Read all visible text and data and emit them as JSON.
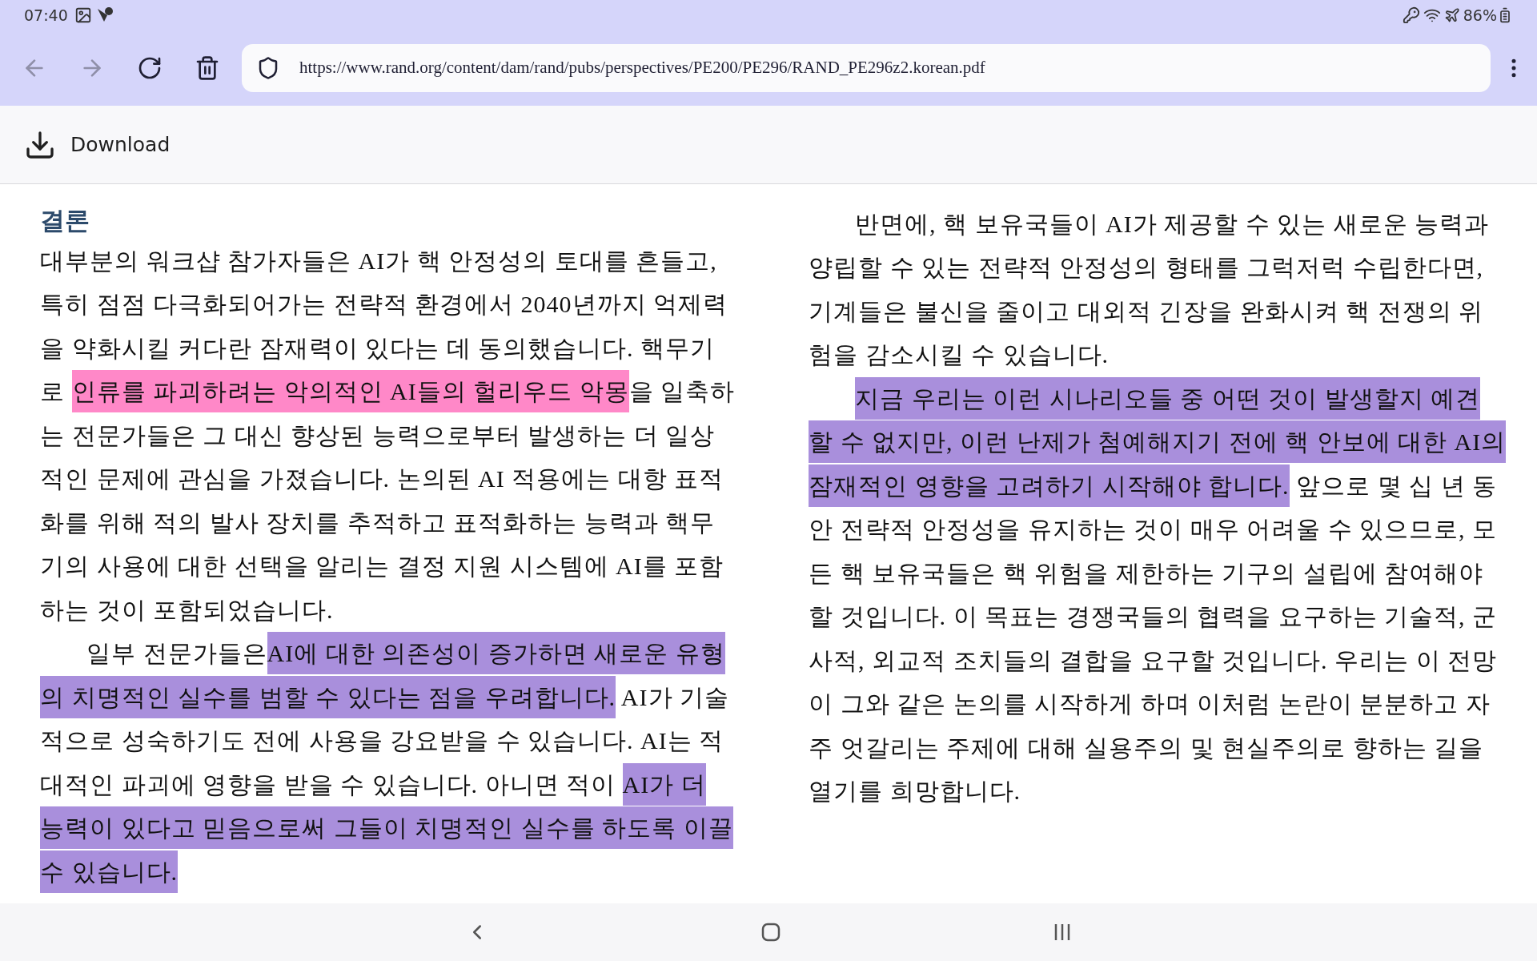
{
  "status_bar": {
    "time": "07:40",
    "battery": "86%"
  },
  "toolbar": {
    "buttons": [
      {
        "kind": "back",
        "disabled": true
      },
      {
        "kind": "forward",
        "disabled": true
      },
      {
        "kind": "reload",
        "disabled": false
      },
      {
        "kind": "delete",
        "disabled": false
      }
    ],
    "url": "https://www.rand.org/content/dam/rand/pubs/perspectives/PE200/PE296/RAND_PE296z2.korean.pdf"
  },
  "download_bar": {
    "label": "Download"
  },
  "document": {
    "columns": [
      {
        "heading": "결론",
        "paragraphs": [
          {
            "indent": false,
            "lines": [
              [
                {
                  "text": "대부분의 워크샵 참가자들은 AI가 핵 안정성의 토대를 흔들고,"
                }
              ],
              [
                {
                  "text": "특히 점점 다극화되어가는 전략적 환경에서 2040년까지 억제력"
                }
              ],
              [
                {
                  "text": "을 약화시킬 커다란 잠재력이 있다는 데 동의했습니다. 핵무기"
                }
              ],
              [
                {
                  "text": "로 "
                },
                {
                  "text": "인류를 파괴하려는 악의적인 AI들의 헐리우드 악몽",
                  "color": "#ff88c8"
                },
                {
                  "text": "을 일축하"
                }
              ],
              [
                {
                  "text": "는 전문가들은 그 대신 향상된 능력으로부터 발생하는 더 일상"
                }
              ],
              [
                {
                  "text": "적인 문제에 관심을 가졌습니다. 논의된 AI 적용에는 대항 표적"
                }
              ],
              [
                {
                  "text": "화를 위해 적의 발사 장치를 추적하고 표적화하는 능력과 핵무"
                }
              ],
              [
                {
                  "text": "기의 사용에 대한 선택을 알리는 결정 지원 시스템에 AI를 포함"
                }
              ],
              [
                {
                  "text": "하는 것이 포함되었습니다."
                }
              ]
            ]
          },
          {
            "indent": true,
            "lines": [
              [
                {
                  "text": "일부 전문가들은"
                },
                {
                  "text": "AI에 대한 의존성이 증가하면 새로운 유형",
                  "color": "#a98fdc"
                }
              ],
              [
                {
                  "text": "의 치명적인 실수를 범할 수 있다는 점을 우려합니다.",
                  "color": "#a98fdc"
                },
                {
                  "text": " AI가 기술"
                }
              ],
              [
                {
                  "text": "적으로 성숙하기도 전에 사용을 강요받을 수 있습니다. AI는 적"
                }
              ],
              [
                {
                  "text": "대적인 파괴에 영향을 받을 수 있습니다. 아니면 적이 "
                },
                {
                  "text": "AI가 더",
                  "color": "#a98fdc"
                }
              ],
              [
                {
                  "text": "능력이 있다고 믿음으로써 그들이 치명적인 실수를 하도록 이끌",
                  "color": "#a98fdc"
                }
              ],
              [
                {
                  "text": "수 있습니다.",
                  "color": "#a98fdc"
                }
              ]
            ]
          }
        ]
      },
      {
        "paragraphs": [
          {
            "indent": true,
            "lines": [
              [
                {
                  "text": "반면에, 핵 보유국들이 AI가 제공할 수 있는 새로운 능력과"
                }
              ],
              [
                {
                  "text": "양립할 수 있는 전략적 안정성의 형태를 그럭저럭 수립한다면,"
                }
              ],
              [
                {
                  "text": "기계들은 불신을 줄이고 대외적 긴장을 완화시켜 핵 전쟁의 위"
                }
              ],
              [
                {
                  "text": "험을 감소시킬 수 있습니다."
                }
              ]
            ]
          },
          {
            "indent": true,
            "lines": [
              [
                {
                  "text": "지금 우리는 이런 시나리오들 중 어떤 것이 발생할지 예견",
                  "color": "#a98fdc"
                }
              ],
              [
                {
                  "text": "할 수 없지만, 이런 난제가 첨예해지기 전에 핵 안보에 대한 AI의",
                  "color": "#a98fdc"
                }
              ],
              [
                {
                  "text": "잠재적인 영향을 고려하기 시작해야 합니다.",
                  "color": "#a98fdc"
                },
                {
                  "text": " 앞으로 몇 십 년 동"
                }
              ],
              [
                {
                  "text": "안 전략적 안정성을 유지하는 것이 매우 어려울 수 있으므로, 모"
                }
              ],
              [
                {
                  "text": "든 핵 보유국들은 핵 위험을 제한하는 기구의 설립에 참여해야"
                }
              ],
              [
                {
                  "text": "할 것입니다. 이 목표는 경쟁국들의 협력을 요구하는 기술적, 군"
                }
              ],
              [
                {
                  "text": "사적, 외교적 조치들의 결합을 요구할 것입니다. 우리는 이 전망"
                }
              ],
              [
                {
                  "text": "이 그와 같은 논의를 시작하게 하며 이처럼 논란이 분분하고 자"
                }
              ],
              [
                {
                  "text": "주 엇갈리는 주제에 대해 실용주의 및 현실주의로 향하는 길을"
                }
              ],
              [
                {
                  "text": "열기를 희망합니다."
                }
              ]
            ]
          }
        ]
      }
    ]
  }
}
